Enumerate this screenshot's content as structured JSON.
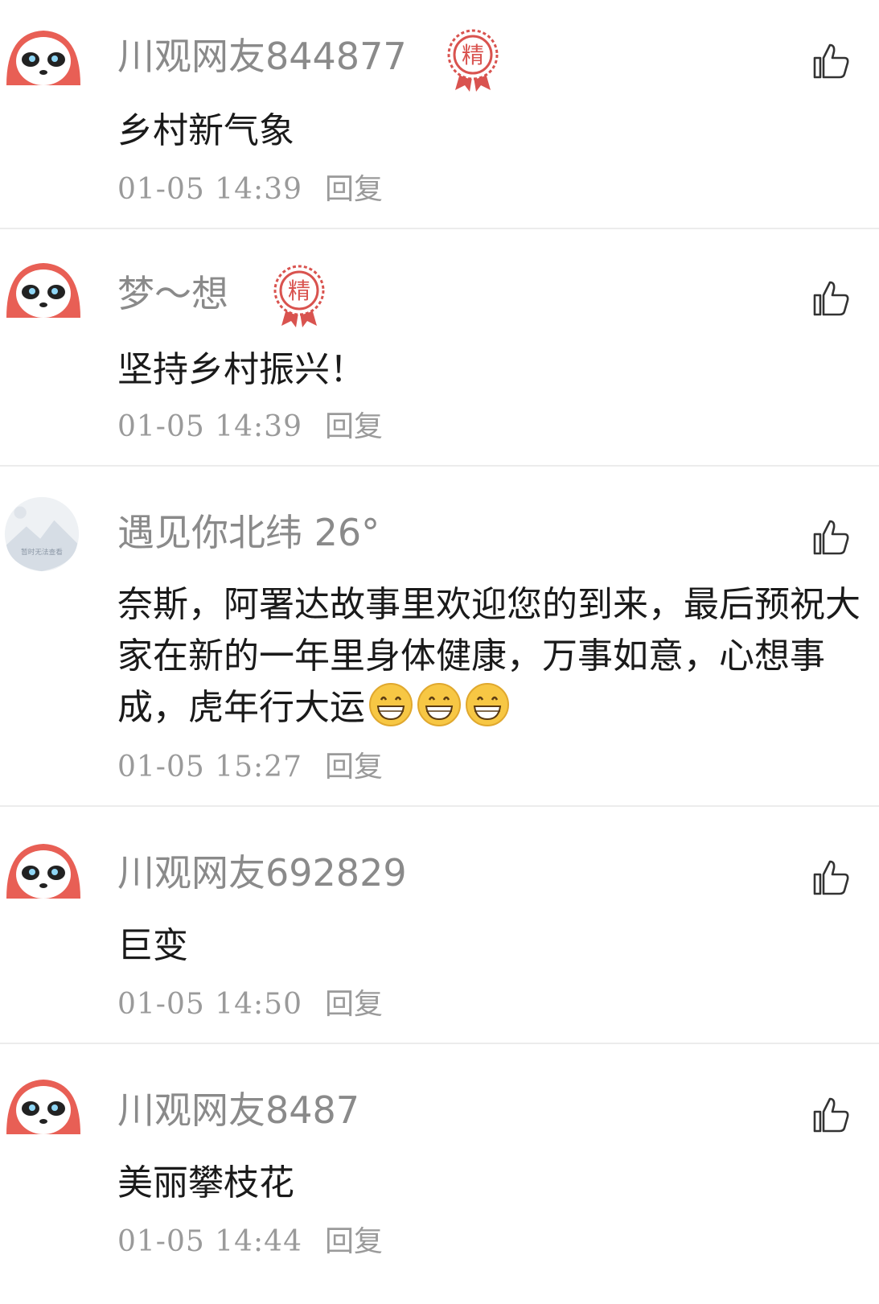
{
  "comments": [
    {
      "username": "川观网友844877",
      "featured": true,
      "badge_text": "精",
      "avatar": "panda-avatar",
      "text": "乡村新气象",
      "time": "01-05  14:39",
      "reply_label": "回复"
    },
    {
      "username": "梦～想",
      "featured": true,
      "badge_text": "精",
      "avatar": "panda-avatar",
      "text": "坚持乡村振兴！",
      "time": "01-05  14:39",
      "reply_label": "回复"
    },
    {
      "username": "遇见你北纬 26°",
      "featured": false,
      "avatar": "placeholder-image-avatar",
      "avatar_text": "暂时无法查看",
      "text": "奈斯，阿署达故事里欢迎您的到来，最后预祝大家在新的一年里身体健康，万事如意，心想事成，虎年行大运",
      "emoji": [
        "grinning-face-icon",
        "grinning-face-icon",
        "grinning-face-icon"
      ],
      "time": "01-05  15:27",
      "reply_label": "回复"
    },
    {
      "username": "川观网友692829",
      "featured": false,
      "avatar": "panda-avatar",
      "text": "巨变",
      "time": "01-05  14:50",
      "reply_label": "回复"
    },
    {
      "username": "川观网友8487",
      "featured": false,
      "avatar": "panda-avatar",
      "text": "美丽攀枝花",
      "time": "01-05  14:44",
      "reply_label": "回复"
    }
  ],
  "colors": {
    "username": "#8a8a8a",
    "text": "#1a1a1a",
    "meta": "#9a9a9a",
    "badge": "#d9534f",
    "panda_red": "#e85f55",
    "divider": "#ececec"
  }
}
